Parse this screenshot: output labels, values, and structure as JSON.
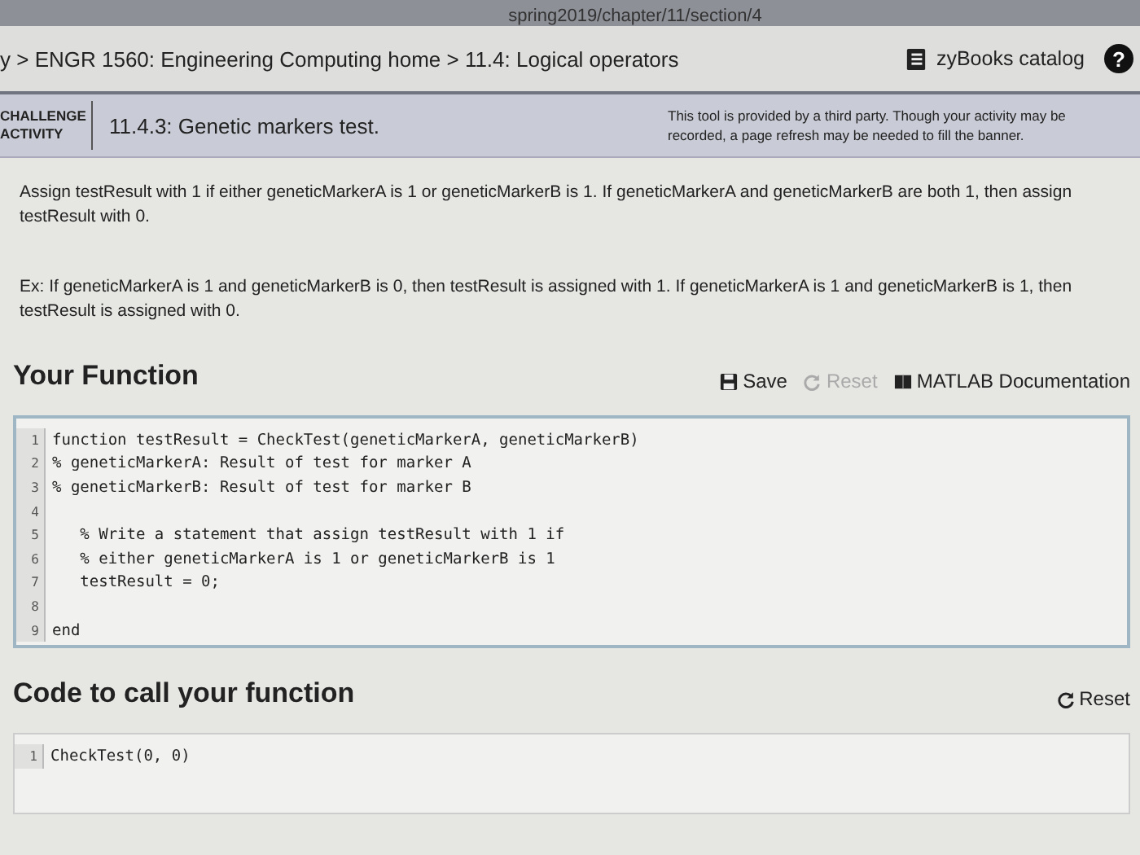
{
  "address_bar": {
    "url": "spring2019/chapter/11/section/4"
  },
  "breadcrumb": {
    "text": "y > ENGR 1560: Engineering Computing home > 11.4: Logical operators",
    "catalog_link": "zyBooks catalog",
    "help": "?"
  },
  "activity": {
    "type_label": [
      "CHALLENGE",
      "ACTIVITY"
    ],
    "title": "11.4.3: Genetic markers test.",
    "notice": "This tool is provided by a third party. Though your activity may be recorded, a page refresh may be needed to fill the banner."
  },
  "instructions": [
    "Assign testResult with 1 if either geneticMarkerA is 1 or geneticMarkerB is 1. If geneticMarkerA and geneticMarkerB are both 1, then assign testResult with 0.",
    "Ex: If geneticMarkerA is 1 and geneticMarkerB is 0, then testResult is assigned with 1. If geneticMarkerA is 1 and geneticMarkerB is 1, then testResult is assigned with 0."
  ],
  "your_function": {
    "heading": "Your Function",
    "toolbar": [
      {
        "kind": "save",
        "label": "Save",
        "disabled": false
      },
      {
        "kind": "reset",
        "label": "Reset",
        "disabled": true
      },
      {
        "kind": "docs",
        "label": "MATLAB Documentation",
        "disabled": false
      }
    ],
    "code_lines": [
      {
        "number": "1",
        "text": "function testResult = CheckTest(geneticMarkerA, geneticMarkerB)"
      },
      {
        "number": "2",
        "text": "% geneticMarkerA: Result of test for marker A"
      },
      {
        "number": "3",
        "text": "% geneticMarkerB: Result of test for marker B"
      },
      {
        "number": "4"
      },
      {
        "number": "5",
        "text": "   % Write a statement that assign testResult with 1 if"
      },
      {
        "number": "6",
        "text": "   % either geneticMarkerA is 1 or geneticMarkerB is 1"
      },
      {
        "number": "7",
        "text": "   testResult = 0;"
      },
      {
        "number": "8"
      },
      {
        "number": "9",
        "text": "end"
      }
    ]
  },
  "call_function": {
    "heading": "Code to call your function",
    "toolbar": [
      {
        "kind": "reset",
        "label": "Reset",
        "disabled": false
      }
    ],
    "code_lines": [
      {
        "number": "1",
        "text": "CheckTest(0, 0)"
      }
    ]
  }
}
